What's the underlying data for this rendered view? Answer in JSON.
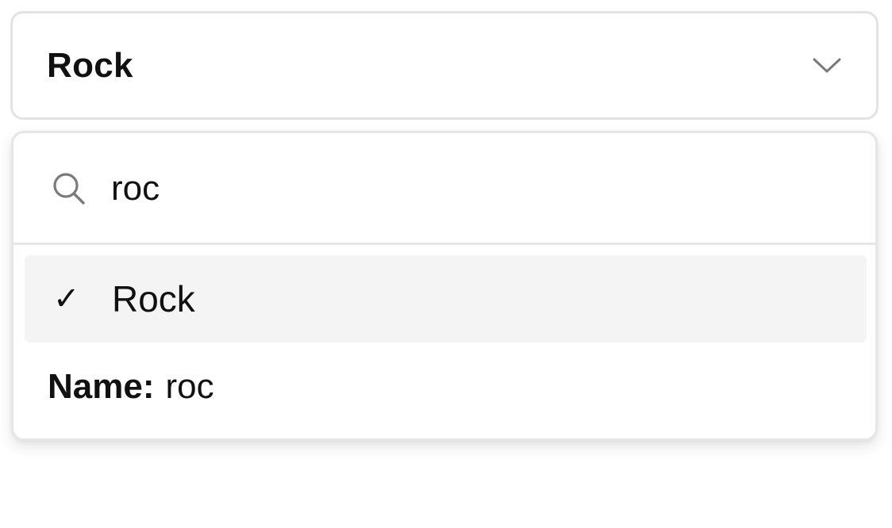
{
  "select": {
    "value": "Rock",
    "chevron_icon": "chevron-down-icon"
  },
  "popover": {
    "search": {
      "icon": "search-icon",
      "value": "roc"
    },
    "options": [
      {
        "label": "Rock",
        "selected": true,
        "check_glyph": "✓"
      }
    ],
    "footer": {
      "key": "Name:",
      "value": "roc"
    }
  }
}
